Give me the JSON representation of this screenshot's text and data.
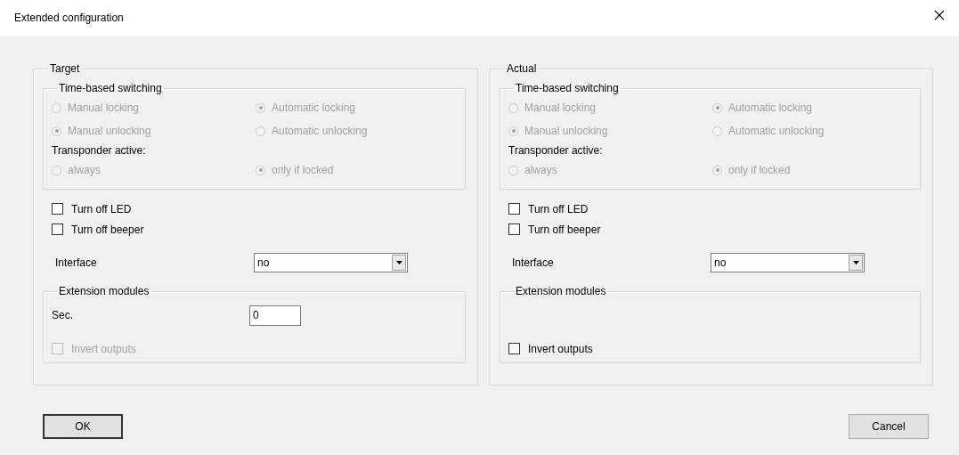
{
  "window": {
    "title": "Extended configuration"
  },
  "panels": [
    {
      "title": "Target",
      "switching": {
        "title": "Time-based switching",
        "disabled": true,
        "options": [
          {
            "label": "Manual locking",
            "selected": false
          },
          {
            "label": "Automatic locking",
            "selected": true
          },
          {
            "label": "Manual unlocking",
            "selected": true
          },
          {
            "label": "Automatic unlocking",
            "selected": false
          }
        ],
        "transponder": {
          "label": "Transponder active:",
          "options": [
            {
              "label": "always",
              "selected": false
            },
            {
              "label": "only if locked",
              "selected": true
            }
          ]
        }
      },
      "checkboxes": [
        {
          "label": "Turn off LED",
          "checked": false
        },
        {
          "label": "Turn off beeper",
          "checked": false
        }
      ],
      "interface": {
        "label": "Interface",
        "value": "no"
      },
      "extension": {
        "title": "Extension modules",
        "seconds": {
          "label": "Sec.",
          "value": "0"
        },
        "invert": {
          "label": "Invert outputs",
          "checked": false,
          "disabled": true
        }
      }
    },
    {
      "title": "Actual",
      "switching": {
        "title": "Time-based switching",
        "disabled": true,
        "options": [
          {
            "label": "Manual locking",
            "selected": false
          },
          {
            "label": "Automatic locking",
            "selected": true
          },
          {
            "label": "Manual unlocking",
            "selected": true
          },
          {
            "label": "Automatic unlocking",
            "selected": false
          }
        ],
        "transponder": {
          "label": "Transponder active:",
          "options": [
            {
              "label": "always",
              "selected": false
            },
            {
              "label": "only if locked",
              "selected": true
            }
          ]
        }
      },
      "checkboxes": [
        {
          "label": "Turn off LED",
          "checked": false
        },
        {
          "label": "Turn off beeper",
          "checked": false
        }
      ],
      "interface": {
        "label": "Interface",
        "value": "no"
      },
      "extension": {
        "title": "Extension modules",
        "invert": {
          "label": "Invert outputs",
          "checked": false,
          "disabled": false
        }
      }
    }
  ],
  "buttons": [
    {
      "label": "OK",
      "kind": "default"
    },
    {
      "label": "Cancel",
      "kind": "normal"
    }
  ]
}
